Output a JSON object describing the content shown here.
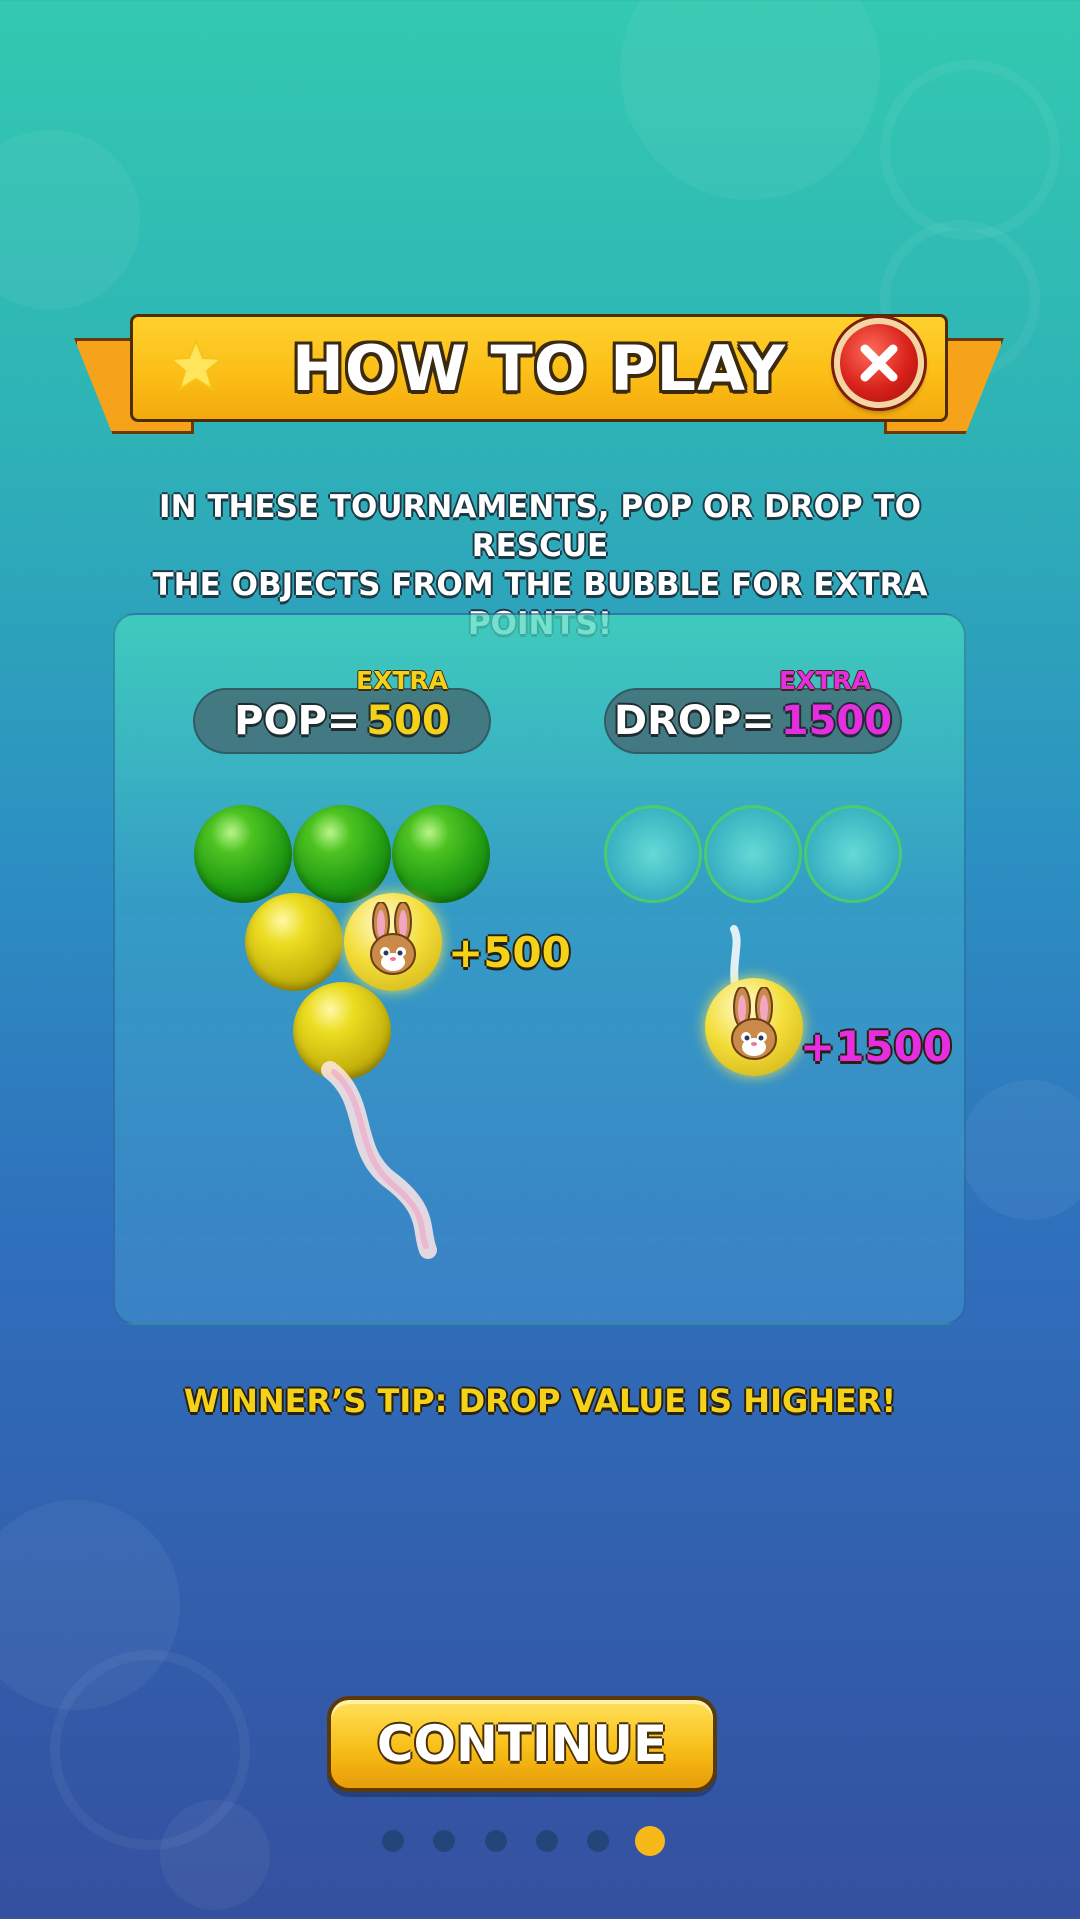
{
  "header": {
    "title": "HOW TO PLAY",
    "icons": {
      "left": "star-icon",
      "close": "close-icon"
    }
  },
  "intro": {
    "line1": "IN THESE TOURNAMENTS, POP OR DROP TO RESCUE",
    "line2": "THE OBJECTS FROM THE BUBBLE FOR EXTRA POINTS!"
  },
  "pop": {
    "extra": "EXTRA",
    "label": "POP=",
    "value": "500",
    "score": "+500"
  },
  "drop": {
    "extra": "EXTRA",
    "label": "DROP=",
    "value": "1500",
    "score": "+1500"
  },
  "tip": "WINNER’S TIP: DROP VALUE IS HIGHER!",
  "continue": {
    "label": "CONTINUE"
  },
  "pagination": {
    "total": 6,
    "current": 6
  },
  "colors": {
    "accent_yellow": "#f4d21a",
    "accent_magenta": "#e52ee0",
    "banner": "#fbbd15",
    "close_red": "#d8211a"
  }
}
